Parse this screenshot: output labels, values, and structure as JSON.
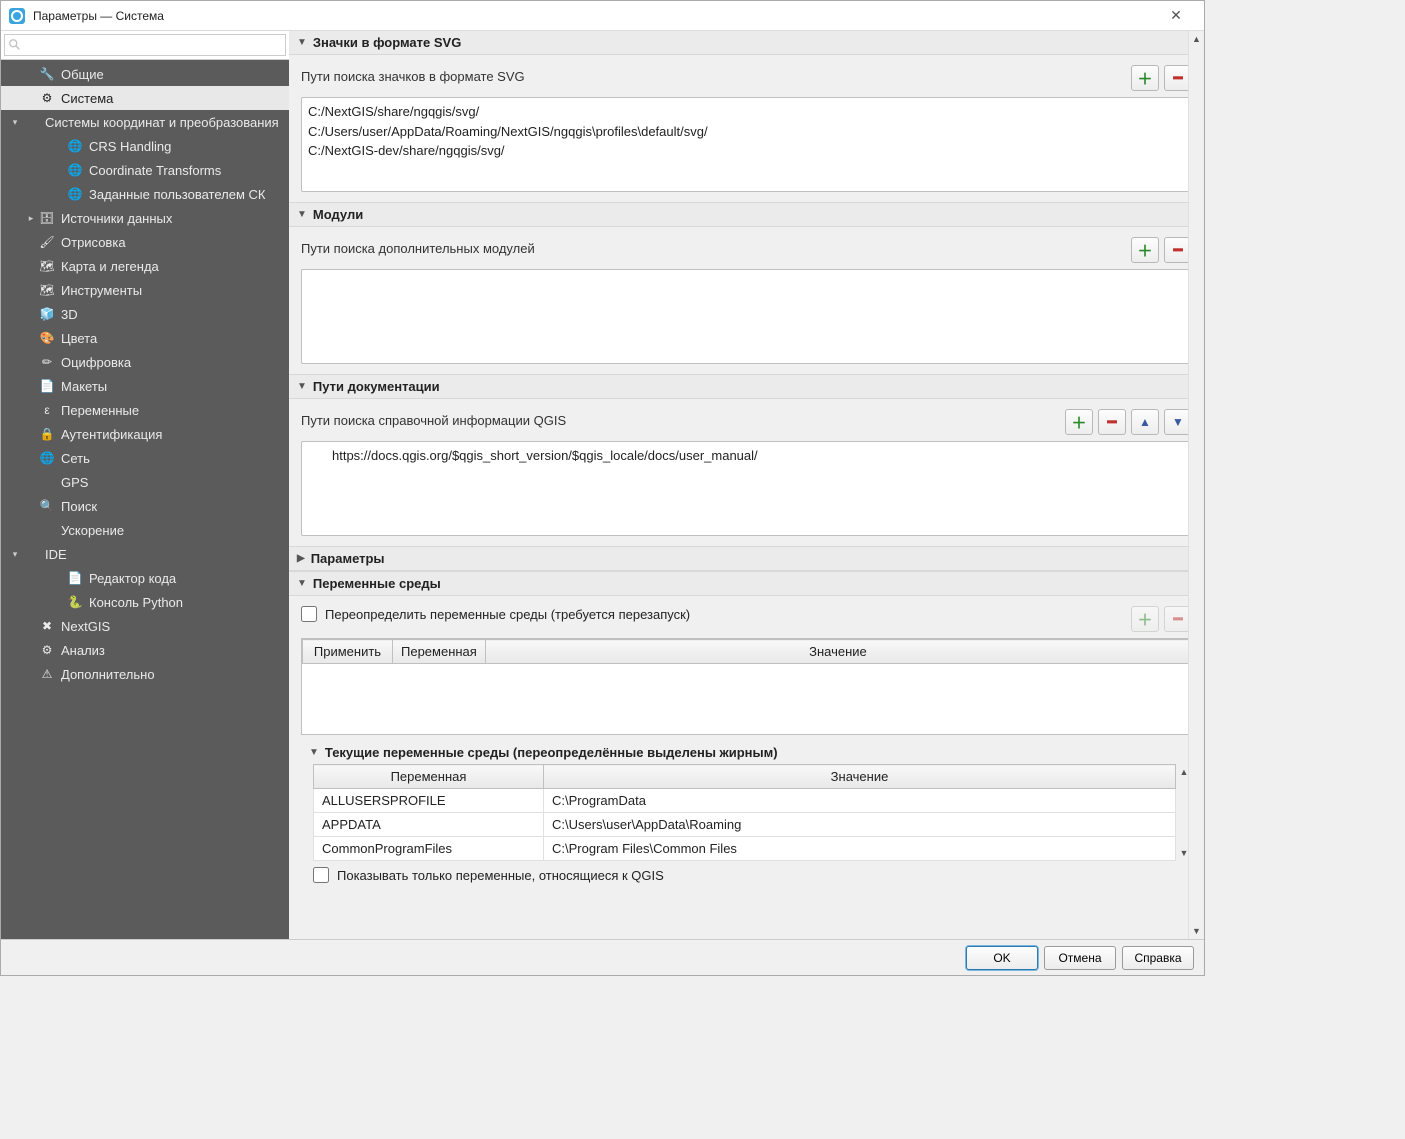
{
  "window": {
    "title": "Параметры — Система"
  },
  "search": {
    "placeholder": ""
  },
  "sidebar": {
    "items": [
      {
        "label": "Общие",
        "icon": "🔧",
        "level": 1,
        "arrow": ""
      },
      {
        "label": "Система",
        "icon": "⚙",
        "level": 1,
        "arrow": "",
        "selected": true
      },
      {
        "label": "Системы координат и преобразования",
        "icon": "",
        "level": 0,
        "arrow": "▾"
      },
      {
        "label": "CRS Handling",
        "icon": "🌐",
        "level": 2,
        "arrow": ""
      },
      {
        "label": "Coordinate Transforms",
        "icon": "🌐",
        "level": 2,
        "arrow": ""
      },
      {
        "label": "Заданные пользователем СК",
        "icon": "🌐",
        "level": 2,
        "arrow": ""
      },
      {
        "label": "Источники данных",
        "icon": "🗄",
        "level": 1,
        "arrow": "▸"
      },
      {
        "label": "Отрисовка",
        "icon": "🖌",
        "level": 1,
        "arrow": ""
      },
      {
        "label": "Карта и легенда",
        "icon": "🗺",
        "level": 1,
        "arrow": ""
      },
      {
        "label": "Инструменты",
        "icon": "🗺",
        "level": 1,
        "arrow": ""
      },
      {
        "label": "3D",
        "icon": "🧊",
        "level": 1,
        "arrow": ""
      },
      {
        "label": "Цвета",
        "icon": "🎨",
        "level": 1,
        "arrow": ""
      },
      {
        "label": "Оцифровка",
        "icon": "✏",
        "level": 1,
        "arrow": ""
      },
      {
        "label": "Макеты",
        "icon": "📄",
        "level": 1,
        "arrow": ""
      },
      {
        "label": "Переменные",
        "icon": "ε",
        "level": 1,
        "arrow": ""
      },
      {
        "label": "Аутентификация",
        "icon": "🔒",
        "level": 1,
        "arrow": ""
      },
      {
        "label": "Сеть",
        "icon": "🌐",
        "level": 1,
        "arrow": ""
      },
      {
        "label": "GPS",
        "icon": "",
        "level": 1,
        "arrow": ""
      },
      {
        "label": "Поиск",
        "icon": "🔍",
        "level": 1,
        "arrow": ""
      },
      {
        "label": "Ускорение",
        "icon": "",
        "level": 1,
        "arrow": ""
      },
      {
        "label": "IDE",
        "icon": "",
        "level": 0,
        "arrow": "▾"
      },
      {
        "label": "Редактор кода",
        "icon": "📄",
        "level": 2,
        "arrow": ""
      },
      {
        "label": "Консоль Python",
        "icon": "🐍",
        "level": 2,
        "arrow": ""
      },
      {
        "label": "NextGIS",
        "icon": "✖",
        "level": 1,
        "arrow": ""
      },
      {
        "label": "Анализ",
        "icon": "⚙",
        "level": 1,
        "arrow": ""
      },
      {
        "label": "Дополнительно",
        "icon": "⚠",
        "level": 1,
        "arrow": ""
      }
    ]
  },
  "sections": {
    "svg": {
      "title": "Значки в формате SVG",
      "label": "Пути поиска значков в формате SVG",
      "paths": [
        "C:/NextGIS/share/ngqgis/svg/",
        "C:/Users/user/AppData/Roaming/NextGIS/ngqgis\\profiles\\default/svg/",
        "C:/NextGIS-dev/share/ngqgis/svg/"
      ]
    },
    "modules": {
      "title": "Модули",
      "label": "Пути поиска дополнительных модулей"
    },
    "docs": {
      "title": "Пути документации",
      "label": "Пути поиска справочной информации QGIS",
      "paths": [
        "https://docs.qgis.org/$qgis_short_version/$qgis_locale/docs/user_manual/"
      ]
    },
    "params": {
      "title": "Параметры"
    },
    "env": {
      "title": "Переменные среды",
      "override_label": "Переопределить переменные среды (требуется перезапуск)",
      "table_headers": {
        "apply": "Применить",
        "variable": "Переменная",
        "value": "Значение"
      },
      "current_title": "Текущие переменные среды (переопределённые выделены жирным)",
      "current_headers": {
        "variable": "Переменная",
        "value": "Значение"
      },
      "current_rows": [
        {
          "variable": "ALLUSERSPROFILE",
          "value": "C:\\ProgramData"
        },
        {
          "variable": "APPDATA",
          "value": "C:\\Users\\user\\AppData\\Roaming"
        },
        {
          "variable": "CommonProgramFiles",
          "value": "C:\\Program Files\\Common Files"
        }
      ],
      "show_qgis_only": "Показывать только переменные, относящиеся к QGIS"
    }
  },
  "buttons": {
    "ok": "OK",
    "cancel": "Отмена",
    "help": "Справка"
  }
}
